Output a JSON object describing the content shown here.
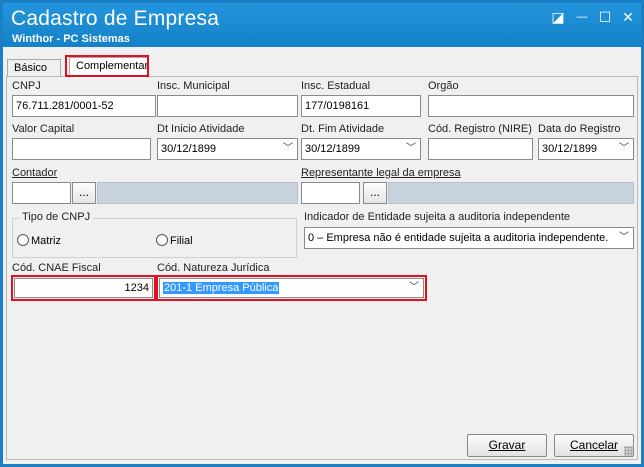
{
  "window": {
    "title": "Cadastro de Empresa",
    "subtitle": "Winthor - PC Sistemas",
    "controls": {
      "restore": "◪",
      "minimize": "—",
      "maximize": "☐",
      "close": "✕"
    }
  },
  "tabs": [
    {
      "label": "Básico"
    },
    {
      "label": "Complementar"
    }
  ],
  "fields": {
    "cnpj": {
      "label": "CNPJ",
      "value": "76.711.281/0001-52"
    },
    "insc_municipal": {
      "label": "Insc. Municipal",
      "value": ""
    },
    "insc_estadual": {
      "label": "Insc. Estadual",
      "value": "177/0198161"
    },
    "orgao": {
      "label": "Orgão",
      "value": ""
    },
    "valor_capital": {
      "label": "Valor Capital",
      "value": ""
    },
    "dt_inicio": {
      "label": "Dt Inicio Atividade",
      "value": "30/12/1899"
    },
    "dt_fim": {
      "label": "Dt. Fim Atividade",
      "value": "30/12/1899"
    },
    "cod_registro": {
      "label": "Cód. Registro (NIRE)",
      "value": ""
    },
    "data_registro": {
      "label": "Data do Registro",
      "value": "30/12/1899"
    },
    "contador": {
      "label": "Contador",
      "value": "",
      "desc": ""
    },
    "representante": {
      "label": "Representante legal da empresa",
      "value": "",
      "desc": ""
    },
    "tipo_cnpj": {
      "label": "Tipo de CNPJ",
      "options": [
        "Matriz",
        "Filial"
      ]
    },
    "indicador": {
      "label": "Indicador de Entidade sujeita a auditoria independente",
      "value": "0 – Empresa não é entidade sujeita a auditoria independente."
    },
    "cnae": {
      "label": "Cód. CNAE Fiscal",
      "value": "1234"
    },
    "natureza": {
      "label": "Cód. Natureza Jurídica",
      "value": "201-1 Empresa Pública"
    }
  },
  "buttons": {
    "dots": "...",
    "gravar": "Gravar",
    "cancelar": "Cancelar"
  },
  "icons": {
    "dropdown": "chevron-down-icon",
    "lookup": "ellipsis-icon"
  },
  "colors": {
    "titlebar": "#1a8ad0",
    "highlight_box": "#e01020",
    "selection": "#3399ff",
    "disabled_field": "#c9d3dd"
  }
}
